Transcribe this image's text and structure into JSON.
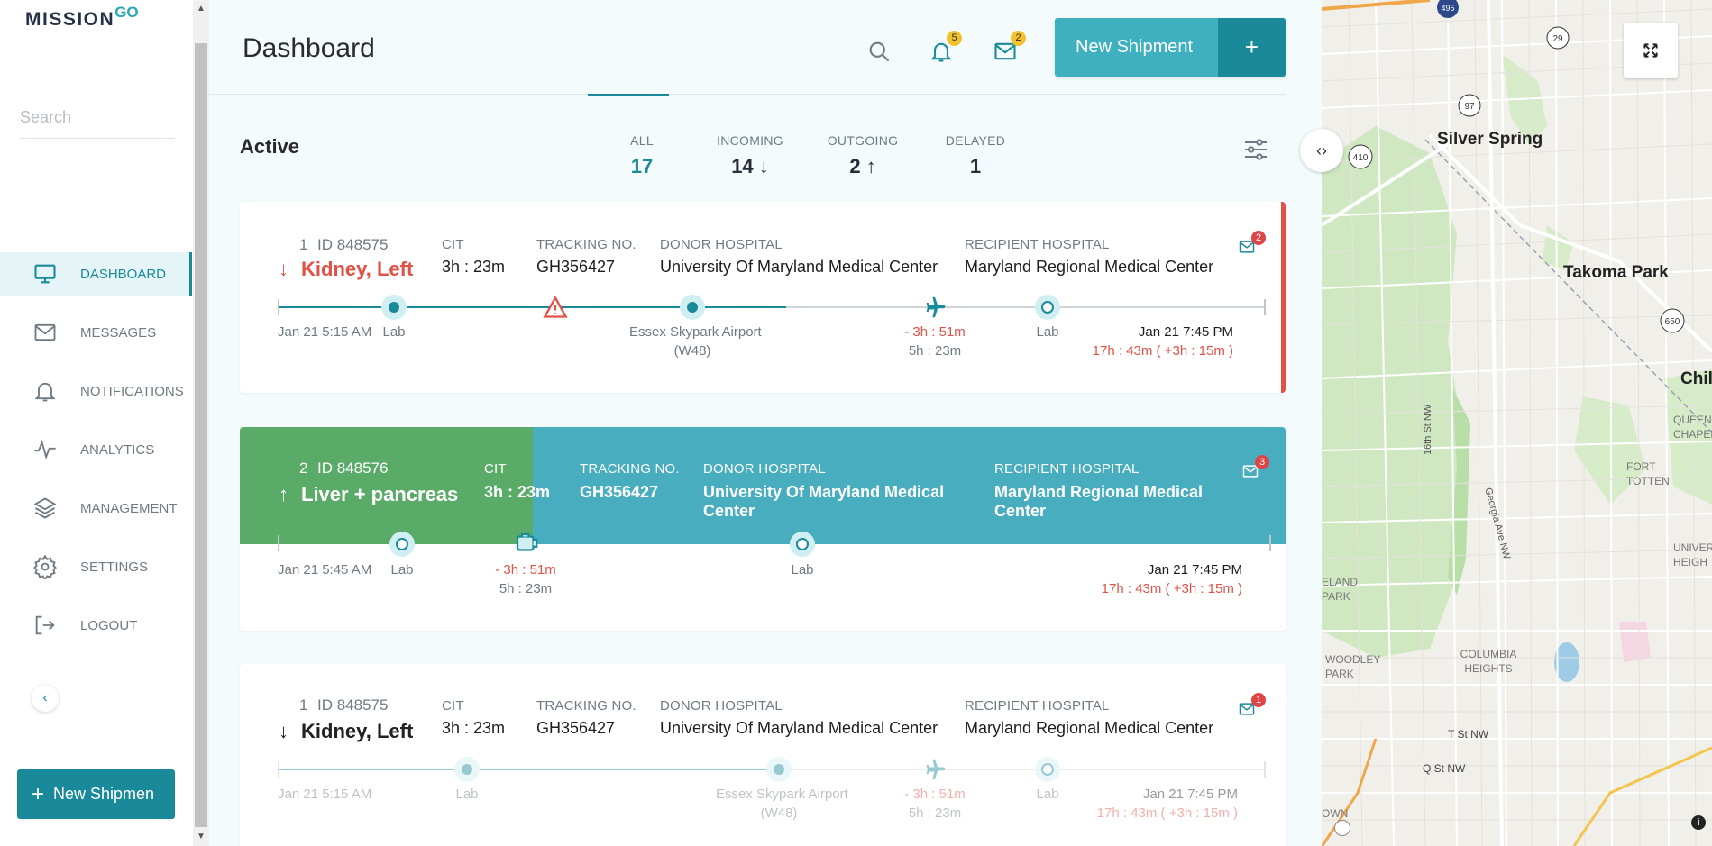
{
  "app": {
    "logo_main": "MISSION",
    "logo_sup": "GO"
  },
  "sidebar": {
    "search_placeholder": "Search",
    "items": [
      {
        "label": "DASHBOARD",
        "icon": "monitor-icon"
      },
      {
        "label": "MESSAGES",
        "icon": "mail-icon"
      },
      {
        "label": "NOTIFICATIONS",
        "icon": "bell-icon"
      },
      {
        "label": "ANALYTICS",
        "icon": "pulse-icon"
      },
      {
        "label": "MANAGEMENT",
        "icon": "layers-icon"
      },
      {
        "label": "SETTINGS",
        "icon": "gear-icon"
      },
      {
        "label": "LOGOUT",
        "icon": "logout-icon"
      }
    ],
    "new_button_label": "New Shipmen"
  },
  "header": {
    "title": "Dashboard",
    "notifications_count": "5",
    "messages_count": "2",
    "new_shipment_label": "New Shipment"
  },
  "active": {
    "title": "Active",
    "filters": [
      {
        "label": "ALL",
        "value": "17",
        "arrow": ""
      },
      {
        "label": "INCOMING",
        "value": "14",
        "arrow": "↓"
      },
      {
        "label": "OUTGOING",
        "value": "2",
        "arrow": "↑"
      },
      {
        "label": "DELAYED",
        "value": "1",
        "arrow": ""
      }
    ]
  },
  "labels": {
    "cit": "CIT",
    "tracking": "TRACKING NO.",
    "donor": "DONOR HOSPITAL",
    "recipient": "RECIPIENT HOSPITAL"
  },
  "cards": [
    {
      "num": "1",
      "id": "ID 848575",
      "organ": "Kidney, Left",
      "direction": "↓",
      "cit": "3h : 23m",
      "tracking": "GH356427",
      "donor": "University Of Maryland Medical Center",
      "recipient": "Maryland Regional Medical Center",
      "mail_count": "2",
      "start_time": "Jan 21 5:15 AM",
      "stop1": "Lab",
      "stop2": "Essex Skypark Airport",
      "stop2_code": "(W48)",
      "flight_delay": "- 3h : 51m",
      "flight_dur": "5h : 23m",
      "stop3": "Lab",
      "end_time": "Jan 21 7:45 PM",
      "end_detail": "17h : 43m ( +3h : 15m )"
    },
    {
      "num": "2",
      "id": "ID 848576",
      "organ": "Liver + pancreas",
      "direction": "↑",
      "cit": "3h : 23m",
      "tracking": "GH356427",
      "donor": "University Of Maryland Medical Center",
      "recipient": "Maryland Regional Medical Center",
      "mail_count": "3",
      "start_time": "Jan 21 5:45 AM",
      "stop1": "Lab",
      "drive_delay": "- 3h : 51m",
      "drive_dur": "5h : 23m",
      "stop2": "Lab",
      "end_time": "Jan 21 7:45 PM",
      "end_detail": "17h : 43m ( +3h : 15m )"
    },
    {
      "num": "1",
      "id": "ID 848575",
      "organ": "Kidney, Left",
      "direction": "↓",
      "cit": "3h : 23m",
      "tracking": "GH356427",
      "donor": "University Of Maryland Medical Center",
      "recipient": "Maryland Regional Medical Center",
      "mail_count": "1",
      "start_time": "Jan 21 5:15 AM",
      "stop1": "Lab",
      "stop2": "Essex Skypark Airport",
      "stop2_code": "(W48)",
      "flight_delay": "- 3h : 51m",
      "flight_dur": "5h : 23m",
      "stop3": "Lab",
      "end_time": "Jan 21 7:45 PM",
      "end_detail": "17h : 43m ( +3h : 15m )"
    }
  ],
  "map": {
    "labels": [
      "Silver Spring",
      "Takoma Park",
      "Chil",
      "QUEENS CHAPEL",
      "FORT TOTTEN",
      "UNIVER HEIGH",
      "ELAND PARK",
      "WOODLEY PARK",
      "COLUMBIA HEIGHTS",
      "T St NW",
      "Q St NW",
      "16th St NW",
      "Georgia Ave NW",
      "OWN"
    ],
    "shields": [
      "495",
      "29",
      "97",
      "410",
      "650"
    ]
  },
  "colors": {
    "accent": "#1a8a9a",
    "accent_light": "#3fb0c0",
    "danger": "#e05247",
    "green": "#5aab68",
    "badge": "#f2c12e"
  }
}
